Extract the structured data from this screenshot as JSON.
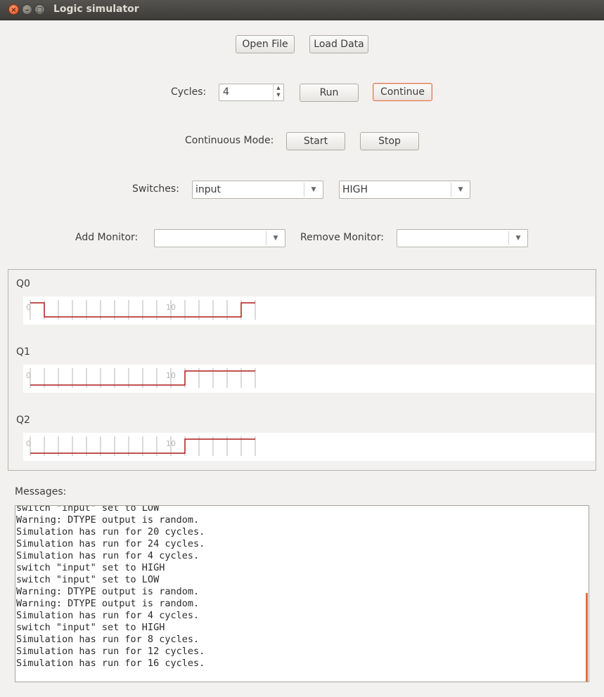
{
  "window": {
    "title": "Logic simulator"
  },
  "toolbar": {
    "open_file": "Open File",
    "load_data": "Load Data"
  },
  "cycles": {
    "label": "Cycles:",
    "value": "4",
    "run": "Run",
    "continue": "Continue"
  },
  "continuous": {
    "label": "Continuous Mode:",
    "start": "Start",
    "stop": "Stop"
  },
  "switches": {
    "label": "Switches:",
    "switch_value": "input",
    "state_value": "HIGH"
  },
  "monitors": {
    "add_label": "Add Monitor:",
    "add_value": "",
    "remove_label": "Remove Monitor:",
    "remove_value": ""
  },
  "traces": [
    {
      "name": "Q0",
      "tick_start": "0",
      "tick_mid": "10",
      "levels": [
        1,
        0,
        0,
        0,
        0,
        0,
        0,
        0,
        0,
        0,
        0,
        0,
        0,
        0,
        0,
        1
      ]
    },
    {
      "name": "Q1",
      "tick_start": "0",
      "tick_mid": "10",
      "levels": [
        0,
        0,
        0,
        0,
        0,
        0,
        0,
        0,
        0,
        0,
        0,
        1,
        1,
        1,
        1,
        1
      ]
    },
    {
      "name": "Q2",
      "tick_start": "0",
      "tick_mid": "10",
      "levels": [
        0,
        0,
        0,
        0,
        0,
        0,
        0,
        0,
        0,
        0,
        0,
        1,
        1,
        1,
        1,
        1
      ]
    }
  ],
  "messages": {
    "label": "Messages:",
    "lines": [
      "switch \"input\" set to LOW",
      "Warning: DTYPE output is random.",
      "Simulation has run for 20 cycles.",
      "Simulation has run for 24 cycles.",
      "Simulation has run for 4 cycles.",
      "switch \"input\" set to HIGH",
      "switch \"input\" set to LOW",
      "Warning: DTYPE output is random.",
      "Warning: DTYPE output is random.",
      "Simulation has run for 4 cycles.",
      "switch \"input\" set to HIGH",
      "Simulation has run for 8 cycles.",
      "Simulation has run for 12 cycles.",
      "Simulation has run for 16 cycles."
    ]
  },
  "colors": {
    "trace": "#b01818",
    "accent": "#e0703e",
    "tick": "#b5b5b5"
  }
}
